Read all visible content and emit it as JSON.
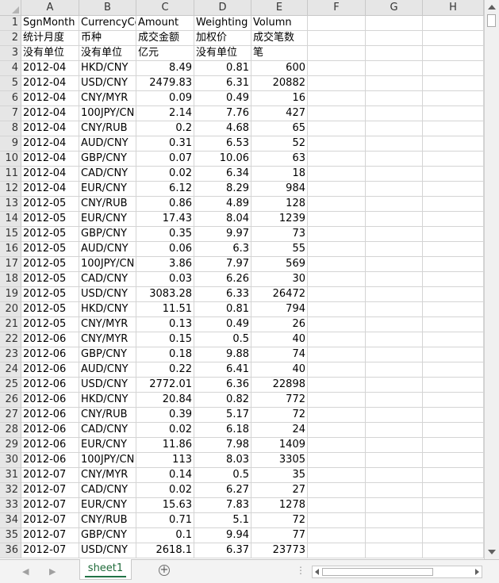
{
  "columns": [
    "A",
    "B",
    "C",
    "D",
    "E",
    "F",
    "G",
    "H"
  ],
  "rows": [
    {
      "n": "1",
      "c": [
        "SgnMonth",
        "CurrencyCo",
        "Amount",
        "Weighting",
        "Volumn"
      ]
    },
    {
      "n": "2",
      "c": [
        "统计月度",
        "币种",
        "成交金额",
        "加权价",
        "成交笔数"
      ]
    },
    {
      "n": "3",
      "c": [
        "没有单位",
        "没有单位",
        "亿元",
        "没有单位",
        "笔"
      ]
    },
    {
      "n": "4",
      "c": [
        "2012-04",
        "HKD/CNY",
        "8.49",
        "0.81",
        "600"
      ]
    },
    {
      "n": "5",
      "c": [
        "2012-04",
        "USD/CNY",
        "2479.83",
        "6.31",
        "20882"
      ]
    },
    {
      "n": "6",
      "c": [
        "2012-04",
        "CNY/MYR",
        "0.09",
        "0.49",
        "16"
      ]
    },
    {
      "n": "7",
      "c": [
        "2012-04",
        "100JPY/CN",
        "2.14",
        "7.76",
        "427"
      ]
    },
    {
      "n": "8",
      "c": [
        "2012-04",
        "CNY/RUB",
        "0.2",
        "4.68",
        "65"
      ]
    },
    {
      "n": "9",
      "c": [
        "2012-04",
        "AUD/CNY",
        "0.31",
        "6.53",
        "52"
      ]
    },
    {
      "n": "10",
      "c": [
        "2012-04",
        "GBP/CNY",
        "0.07",
        "10.06",
        "63"
      ]
    },
    {
      "n": "11",
      "c": [
        "2012-04",
        "CAD/CNY",
        "0.02",
        "6.34",
        "18"
      ]
    },
    {
      "n": "12",
      "c": [
        "2012-04",
        "EUR/CNY",
        "6.12",
        "8.29",
        "984"
      ]
    },
    {
      "n": "13",
      "c": [
        "2012-05",
        "CNY/RUB",
        "0.86",
        "4.89",
        "128"
      ]
    },
    {
      "n": "14",
      "c": [
        "2012-05",
        "EUR/CNY",
        "17.43",
        "8.04",
        "1239"
      ]
    },
    {
      "n": "15",
      "c": [
        "2012-05",
        "GBP/CNY",
        "0.35",
        "9.97",
        "73"
      ]
    },
    {
      "n": "16",
      "c": [
        "2012-05",
        "AUD/CNY",
        "0.06",
        "6.3",
        "55"
      ]
    },
    {
      "n": "17",
      "c": [
        "2012-05",
        "100JPY/CN",
        "3.86",
        "7.97",
        "569"
      ]
    },
    {
      "n": "18",
      "c": [
        "2012-05",
        "CAD/CNY",
        "0.03",
        "6.26",
        "30"
      ]
    },
    {
      "n": "19",
      "c": [
        "2012-05",
        "USD/CNY",
        "3083.28",
        "6.33",
        "26472"
      ]
    },
    {
      "n": "20",
      "c": [
        "2012-05",
        "HKD/CNY",
        "11.51",
        "0.81",
        "794"
      ]
    },
    {
      "n": "21",
      "c": [
        "2012-05",
        "CNY/MYR",
        "0.13",
        "0.49",
        "26"
      ]
    },
    {
      "n": "22",
      "c": [
        "2012-06",
        "CNY/MYR",
        "0.15",
        "0.5",
        "40"
      ]
    },
    {
      "n": "23",
      "c": [
        "2012-06",
        "GBP/CNY",
        "0.18",
        "9.88",
        "74"
      ]
    },
    {
      "n": "24",
      "c": [
        "2012-06",
        "AUD/CNY",
        "0.22",
        "6.41",
        "40"
      ]
    },
    {
      "n": "25",
      "c": [
        "2012-06",
        "USD/CNY",
        "2772.01",
        "6.36",
        "22898"
      ]
    },
    {
      "n": "26",
      "c": [
        "2012-06",
        "HKD/CNY",
        "20.84",
        "0.82",
        "772"
      ]
    },
    {
      "n": "27",
      "c": [
        "2012-06",
        "CNY/RUB",
        "0.39",
        "5.17",
        "72"
      ]
    },
    {
      "n": "28",
      "c": [
        "2012-06",
        "CAD/CNY",
        "0.02",
        "6.18",
        "24"
      ]
    },
    {
      "n": "29",
      "c": [
        "2012-06",
        "EUR/CNY",
        "11.86",
        "7.98",
        "1409"
      ]
    },
    {
      "n": "30",
      "c": [
        "2012-06",
        "100JPY/CN",
        "113",
        "8.03",
        "3305"
      ]
    },
    {
      "n": "31",
      "c": [
        "2012-07",
        "CNY/MYR",
        "0.14",
        "0.5",
        "35"
      ]
    },
    {
      "n": "32",
      "c": [
        "2012-07",
        "CAD/CNY",
        "0.02",
        "6.27",
        "27"
      ]
    },
    {
      "n": "33",
      "c": [
        "2012-07",
        "EUR/CNY",
        "15.63",
        "7.83",
        "1278"
      ]
    },
    {
      "n": "34",
      "c": [
        "2012-07",
        "CNY/RUB",
        "0.71",
        "5.1",
        "72"
      ]
    },
    {
      "n": "35",
      "c": [
        "2012-07",
        "GBP/CNY",
        "0.1",
        "9.94",
        "77"
      ]
    },
    {
      "n": "36",
      "c": [
        "2012-07",
        "USD/CNY",
        "2618.1",
        "6.37",
        "23773"
      ]
    }
  ],
  "sheet_tab": "sheet1",
  "add_sheet_symbol": "+",
  "more_symbol": "⋮",
  "nav_prev": "◀",
  "nav_next": "▶"
}
